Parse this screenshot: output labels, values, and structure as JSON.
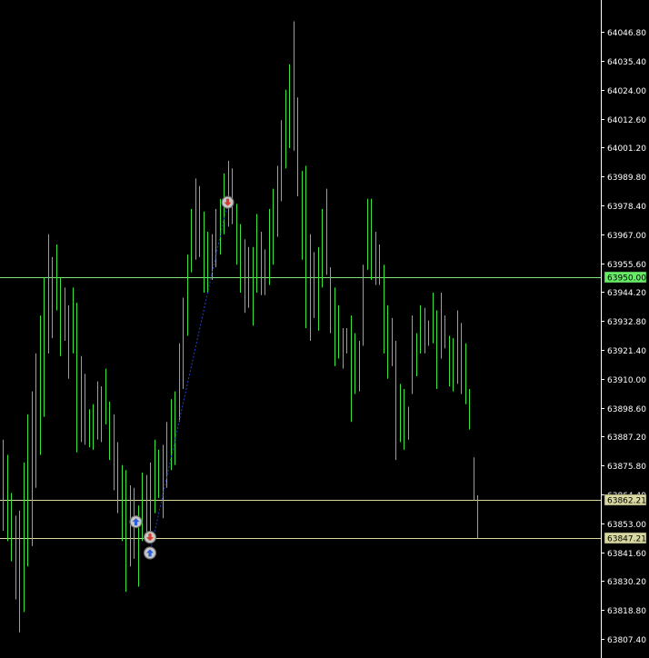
{
  "chart_data": {
    "type": "bar",
    "style": "ohlc-bars",
    "title": "",
    "xlabel": "",
    "ylabel": "",
    "ylim": [
      63800.0,
      64058.0
    ],
    "grid": false,
    "legend": "none",
    "y_axis_position": "right",
    "y_ticks": [
      "64046.80",
      "64035.40",
      "64024.00",
      "64012.60",
      "64001.20",
      "63989.80",
      "63978.40",
      "63967.00",
      "63955.60",
      "63944.20",
      "63932.80",
      "63921.40",
      "63910.00",
      "63898.60",
      "63887.20",
      "63875.80",
      "63864.40",
      "63853.00",
      "63841.60",
      "63830.20",
      "63818.80",
      "63807.40"
    ],
    "colors": {
      "background": "#000000",
      "bars": "#39e639",
      "hline_green": "#7fe07f",
      "hline_yellow": "#d8d8a0",
      "tag_green": "#66ee66",
      "tag_yellow": "#d8d8a0",
      "axis_text": "#ffffff",
      "trade_line": "#2244cc"
    },
    "horizontal_lines": [
      {
        "price": 63950.0,
        "label": "63950.00",
        "color": "#7fe07f"
      },
      {
        "price": 63862.21,
        "label": "63862.21",
        "color": "#d8d8a0"
      },
      {
        "price": 63847.21,
        "label": "63847.21",
        "color": "#d8d8a0"
      }
    ],
    "bars": [
      {
        "h": 63886,
        "l": 63850
      },
      {
        "h": 63880,
        "l": 63846
      },
      {
        "h": 63865,
        "l": 63838
      },
      {
        "h": 63856,
        "l": 63823
      },
      {
        "h": 63858,
        "l": 63810
      },
      {
        "h": 63877,
        "l": 63818
      },
      {
        "h": 63896,
        "l": 63836
      },
      {
        "h": 63905,
        "l": 63844
      },
      {
        "h": 63920,
        "l": 63867
      },
      {
        "h": 63935,
        "l": 63880
      },
      {
        "h": 63950,
        "l": 63895
      },
      {
        "h": 63967,
        "l": 63920
      },
      {
        "h": 63958,
        "l": 63926
      },
      {
        "h": 63963,
        "l": 63937
      },
      {
        "h": 63950,
        "l": 63919
      },
      {
        "h": 63946,
        "l": 63925
      },
      {
        "h": 63939,
        "l": 63910
      },
      {
        "h": 63946,
        "l": 63920
      },
      {
        "h": 63940,
        "l": 63881
      },
      {
        "h": 63919,
        "l": 63885
      },
      {
        "h": 63912,
        "l": 63884
      },
      {
        "h": 63898,
        "l": 63883
      },
      {
        "h": 63900,
        "l": 63882
      },
      {
        "h": 63909,
        "l": 63886
      },
      {
        "h": 63907,
        "l": 63885
      },
      {
        "h": 63914,
        "l": 63892
      },
      {
        "h": 63901,
        "l": 63878
      },
      {
        "h": 63896,
        "l": 63866
      },
      {
        "h": 63885,
        "l": 63857
      },
      {
        "h": 63876,
        "l": 63846
      },
      {
        "h": 63874,
        "l": 63826
      },
      {
        "h": 63868,
        "l": 63836
      },
      {
        "h": 63867,
        "l": 63839
      },
      {
        "h": 63860,
        "l": 63828
      },
      {
        "h": 63873,
        "l": 63846
      },
      {
        "h": 63872,
        "l": 63848
      },
      {
        "h": 63877,
        "l": 63848
      },
      {
        "h": 63886,
        "l": 63857
      },
      {
        "h": 63882,
        "l": 63863
      },
      {
        "h": 63884,
        "l": 63855
      },
      {
        "h": 63893,
        "l": 63867
      },
      {
        "h": 63902,
        "l": 63874
      },
      {
        "h": 63905,
        "l": 63876
      },
      {
        "h": 63924,
        "l": 63893
      },
      {
        "h": 63942,
        "l": 63906
      },
      {
        "h": 63959,
        "l": 63927
      },
      {
        "h": 63977,
        "l": 63952
      },
      {
        "h": 63989,
        "l": 63957
      },
      {
        "h": 63986,
        "l": 63958
      },
      {
        "h": 63976,
        "l": 63944
      },
      {
        "h": 63968,
        "l": 63944
      },
      {
        "h": 63967,
        "l": 63949
      },
      {
        "h": 63977,
        "l": 63954
      },
      {
        "h": 63981,
        "l": 63959
      },
      {
        "h": 63991,
        "l": 63967
      },
      {
        "h": 63996,
        "l": 63970
      },
      {
        "h": 63993,
        "l": 63971
      },
      {
        "h": 63979,
        "l": 63955
      },
      {
        "h": 63971,
        "l": 63944
      },
      {
        "h": 63965,
        "l": 63936
      },
      {
        "h": 63962,
        "l": 63938
      },
      {
        "h": 63962,
        "l": 63931
      },
      {
        "h": 63975,
        "l": 63944
      },
      {
        "h": 63968,
        "l": 63943
      },
      {
        "h": 63961,
        "l": 63943
      },
      {
        "h": 63977,
        "l": 63947
      },
      {
        "h": 63985,
        "l": 63955
      },
      {
        "h": 63994,
        "l": 63966
      },
      {
        "h": 64012,
        "l": 63980
      },
      {
        "h": 64024,
        "l": 63993
      },
      {
        "h": 64034,
        "l": 64001
      },
      {
        "h": 64051,
        "l": 64000
      },
      {
        "h": 64021,
        "l": 63982
      },
      {
        "h": 63992,
        "l": 63957
      },
      {
        "h": 63994,
        "l": 63930
      },
      {
        "h": 63967,
        "l": 63925
      },
      {
        "h": 63960,
        "l": 63934
      },
      {
        "h": 63962,
        "l": 63929
      },
      {
        "h": 63977,
        "l": 63946
      },
      {
        "h": 63985,
        "l": 63951
      },
      {
        "h": 63954,
        "l": 63928
      },
      {
        "h": 63946,
        "l": 63915
      },
      {
        "h": 63939,
        "l": 63918
      },
      {
        "h": 63930,
        "l": 63914
      },
      {
        "h": 63930,
        "l": 63920
      },
      {
        "h": 63935,
        "l": 63893
      },
      {
        "h": 63928,
        "l": 63904
      },
      {
        "h": 63925,
        "l": 63905
      },
      {
        "h": 63955,
        "l": 63923
      },
      {
        "h": 63981,
        "l": 63953
      },
      {
        "h": 63981,
        "l": 63949
      },
      {
        "h": 63968,
        "l": 63947
      },
      {
        "h": 63963,
        "l": 63947
      },
      {
        "h": 63955,
        "l": 63920
      },
      {
        "h": 63939,
        "l": 63910
      },
      {
        "h": 63934,
        "l": 63915
      },
      {
        "h": 63925,
        "l": 63878
      },
      {
        "h": 63908,
        "l": 63885
      },
      {
        "h": 63906,
        "l": 63882
      },
      {
        "h": 63899,
        "l": 63886
      },
      {
        "h": 63935,
        "l": 63904
      },
      {
        "h": 63928,
        "l": 63911
      },
      {
        "h": 63939,
        "l": 63920
      },
      {
        "h": 63938,
        "l": 63920
      },
      {
        "h": 63933,
        "l": 63923
      },
      {
        "h": 63944,
        "l": 63924
      },
      {
        "h": 63937,
        "l": 63906
      },
      {
        "h": 63944,
        "l": 63918
      },
      {
        "h": 63935,
        "l": 63922
      },
      {
        "h": 63927,
        "l": 63907
      },
      {
        "h": 63926,
        "l": 63905
      },
      {
        "h": 63937,
        "l": 63908
      },
      {
        "h": 63932,
        "l": 63904
      },
      {
        "h": 63924,
        "l": 63900
      },
      {
        "h": 63906,
        "l": 63890
      },
      {
        "h": 63879,
        "l": 63862
      },
      {
        "h": 63864,
        "l": 63847
      }
    ],
    "trades": [
      {
        "bar": 33,
        "price": 63853.6,
        "kind": "buy"
      },
      {
        "bar": 36,
        "price": 63847.5,
        "kind": "sell"
      },
      {
        "bar": 36,
        "price": 63841.3,
        "kind": "buy"
      },
      {
        "bar": 55,
        "price": 63979.6,
        "kind": "sell"
      }
    ],
    "trade_lines": [
      {
        "from_bar": 36,
        "from_price": 63841.3,
        "to_bar": 55,
        "to_price": 63979.6
      }
    ]
  }
}
